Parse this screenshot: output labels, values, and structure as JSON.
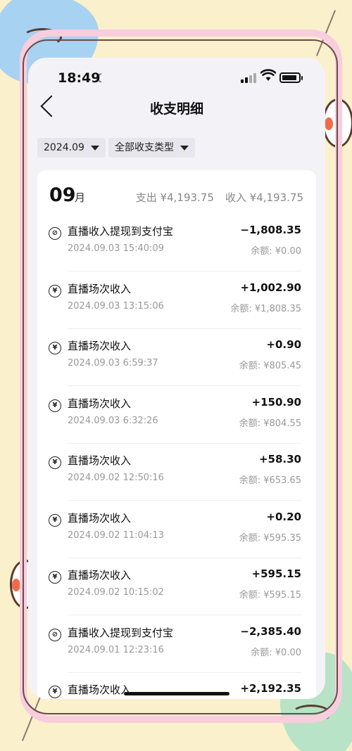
{
  "status_bar": {
    "time": "18:49"
  },
  "nav": {
    "title": "收支明细"
  },
  "filters": {
    "month": "2024.09",
    "type": "全部收支类型"
  },
  "month_header": {
    "month": "09",
    "unit": "月",
    "expense": "支出 ¥4,193.75",
    "income": "收入 ¥4,193.75"
  },
  "transactions": [
    {
      "icon": "withdraw-icon",
      "title": "直播收入提现到支付宝",
      "time": "2024.09.03 15:40:09",
      "amount": "−1,808.35",
      "balance": "余额: ¥0.00"
    },
    {
      "icon": "income-icon",
      "title": "直播场次收入",
      "time": "2024.09.03 13:15:06",
      "amount": "+1,002.90",
      "balance": "余额: ¥1,808.35"
    },
    {
      "icon": "income-icon",
      "title": "直播场次收入",
      "time": "2024.09.03 6:59:37",
      "amount": "+0.90",
      "balance": "余额: ¥805.45"
    },
    {
      "icon": "income-icon",
      "title": "直播场次收入",
      "time": "2024.09.03 6:32:26",
      "amount": "+150.90",
      "balance": "余额: ¥804.55"
    },
    {
      "icon": "income-icon",
      "title": "直播场次收入",
      "time": "2024.09.02 12:50:16",
      "amount": "+58.30",
      "balance": "余额: ¥653.65"
    },
    {
      "icon": "income-icon",
      "title": "直播场次收入",
      "time": "2024.09.02 11:04:13",
      "amount": "+0.20",
      "balance": "余额: ¥595.35"
    },
    {
      "icon": "income-icon",
      "title": "直播场次收入",
      "time": "2024.09.02 10:15:02",
      "amount": "+595.15",
      "balance": "余额: ¥595.15"
    },
    {
      "icon": "withdraw-icon",
      "title": "直播收入提现到支付宝",
      "time": "2024.09.01 12:23:16",
      "amount": "−2,385.40",
      "balance": "余额: ¥0.00"
    },
    {
      "icon": "income-icon",
      "title": "直播场次收入",
      "time": "",
      "amount": "+2,192.35",
      "balance": ""
    }
  ]
}
